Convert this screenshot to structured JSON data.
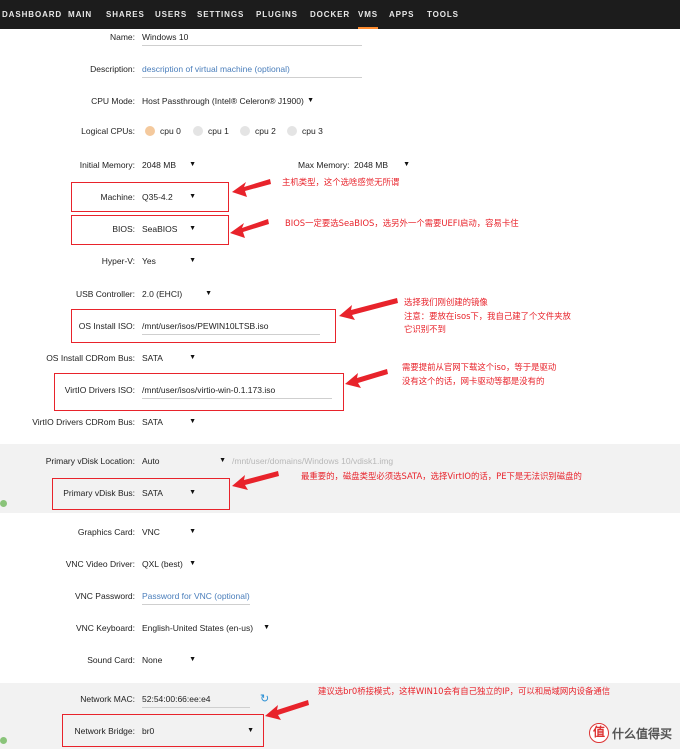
{
  "nav": {
    "items": [
      "DASHBOARD",
      "MAIN",
      "SHARES",
      "USERS",
      "SETTINGS",
      "PLUGINS",
      "DOCKER",
      "VMS",
      "APPS",
      "TOOLS"
    ],
    "active": "VMS",
    "accent": "#ff8c2f"
  },
  "form": {
    "name": {
      "label": "Name:",
      "value": "Windows 10"
    },
    "description": {
      "label": "Description:",
      "placeholder": "description of virtual machine (optional)"
    },
    "cpu_mode": {
      "label": "CPU Mode:",
      "value": "Host Passthrough (Intel® Celeron® J1900)"
    },
    "logical_cpus": {
      "label": "Logical CPUs:",
      "options": [
        "cpu 0",
        "cpu 1",
        "cpu 2",
        "cpu 3"
      ],
      "checked": [
        "cpu 0"
      ]
    },
    "initial_memory": {
      "label": "Initial Memory:",
      "value": "2048 MB"
    },
    "max_memory": {
      "label": "Max Memory:",
      "value": "2048 MB"
    },
    "machine": {
      "label": "Machine:",
      "value": "Q35-4.2"
    },
    "bios": {
      "label": "BIOS:",
      "value": "SeaBIOS"
    },
    "hyperv": {
      "label": "Hyper-V:",
      "value": "Yes"
    },
    "usb_controller": {
      "label": "USB Controller:",
      "value": "2.0 (EHCI)"
    },
    "os_install_iso": {
      "label": "OS Install ISO:",
      "value": "/mnt/user/isos/PEWIN10LTSB.iso"
    },
    "os_install_cdrom_bus": {
      "label": "OS Install CDRom Bus:",
      "value": "SATA"
    },
    "virtio_iso": {
      "label": "VirtIO Drivers ISO:",
      "value": "/mnt/user/isos/virtio-win-0.1.173.iso"
    },
    "virtio_cdrom_bus": {
      "label": "VirtIO Drivers CDRom Bus:",
      "value": "SATA"
    },
    "vdisk_location": {
      "label": "Primary vDisk Location:",
      "value": "Auto",
      "path": "/mnt/user/domains/Windows 10/vdisk1.img"
    },
    "vdisk_bus": {
      "label": "Primary vDisk Bus:",
      "value": "SATA"
    },
    "graphics_card": {
      "label": "Graphics Card:",
      "value": "VNC"
    },
    "vnc_video_driver": {
      "label": "VNC Video Driver:",
      "value": "QXL (best)"
    },
    "vnc_password": {
      "label": "VNC Password:",
      "placeholder": "Password for VNC (optional)"
    },
    "vnc_keyboard": {
      "label": "VNC Keyboard:",
      "value": "English-United States (en-us)"
    },
    "sound_card": {
      "label": "Sound Card:",
      "value": "None"
    },
    "network_mac": {
      "label": "Network MAC:",
      "value": "52:54:00:66:ee:e4"
    },
    "network_bridge": {
      "label": "Network Bridge:",
      "value": "br0"
    }
  },
  "annotations": {
    "machine": "主机类型，这个选啥感觉无所谓",
    "bios": "BIOS一定要选SeaBIOS，选另外一个需要UEFI启动，容易卡住",
    "os_iso": [
      "选择我们刚创建的镜像",
      "注意：要放在isos下，我自己建了个文件夹放",
      "它识别不到"
    ],
    "virtio": [
      "需要提前从官网下载这个iso，等于是驱动",
      "没有这个的话，网卡驱动等都是没有的"
    ],
    "vdisk_bus": "最重要的，磁盘类型必须选SATA，选择VirtIO的话，PE下是无法识别磁盘的",
    "network": "建议选br0桥接模式，这样WIN10会有自己独立的IP，可以和局域网内设备通信"
  },
  "watermark": "值 什么值得买",
  "icons": {
    "refresh": "refresh-icon",
    "arrow": "red-arrow-icon"
  },
  "colors": {
    "annotation_red": "#e8232b",
    "link_blue": "#4a7ebb"
  }
}
